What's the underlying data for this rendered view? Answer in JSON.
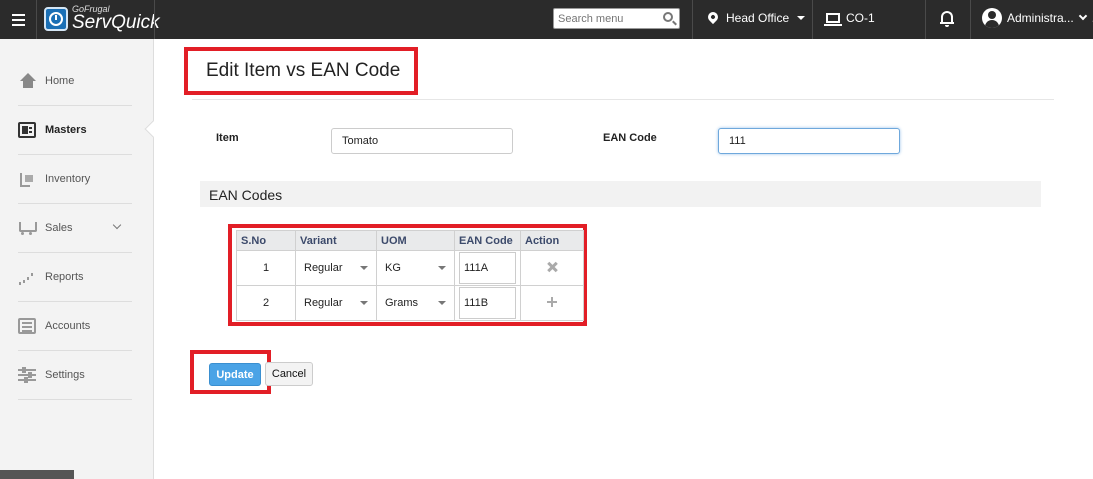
{
  "topbar": {
    "brand_small": "GoFrugal",
    "brand_name": "ServQuick",
    "search_placeholder": "Search menu",
    "location": "Head Office",
    "counter": "CO-1",
    "user": "Administra...",
    "more": "..."
  },
  "sidebar": {
    "items": [
      {
        "label": "Home",
        "icon": "home-icon"
      },
      {
        "label": "Masters",
        "icon": "masters-icon"
      },
      {
        "label": "Inventory",
        "icon": "inventory-icon"
      },
      {
        "label": "Sales",
        "icon": "cart-icon"
      },
      {
        "label": "Reports",
        "icon": "reports-icon"
      },
      {
        "label": "Accounts",
        "icon": "accounts-icon"
      },
      {
        "label": "Settings",
        "icon": "settings-icon"
      }
    ]
  },
  "page": {
    "title": "Edit Item vs EAN Code",
    "item_label": "Item",
    "item_value": "Tomato",
    "ean_label": "EAN Code",
    "ean_value": "111",
    "section_title": "EAN Codes"
  },
  "table": {
    "headers": [
      "S.No",
      "Variant",
      "UOM",
      "EAN Code",
      "Action"
    ],
    "rows": [
      {
        "sno": "1",
        "variant": "Regular",
        "uom": "KG",
        "ean": "111A",
        "action": "remove"
      },
      {
        "sno": "2",
        "variant": "Regular",
        "uom": "Grams",
        "ean": "111B",
        "action": "add"
      }
    ]
  },
  "buttons": {
    "update": "Update",
    "cancel": "Cancel"
  },
  "colors": {
    "topbar": "#2b2b2b",
    "highlight": "#e21e26",
    "primary": "#4aa3e6"
  }
}
